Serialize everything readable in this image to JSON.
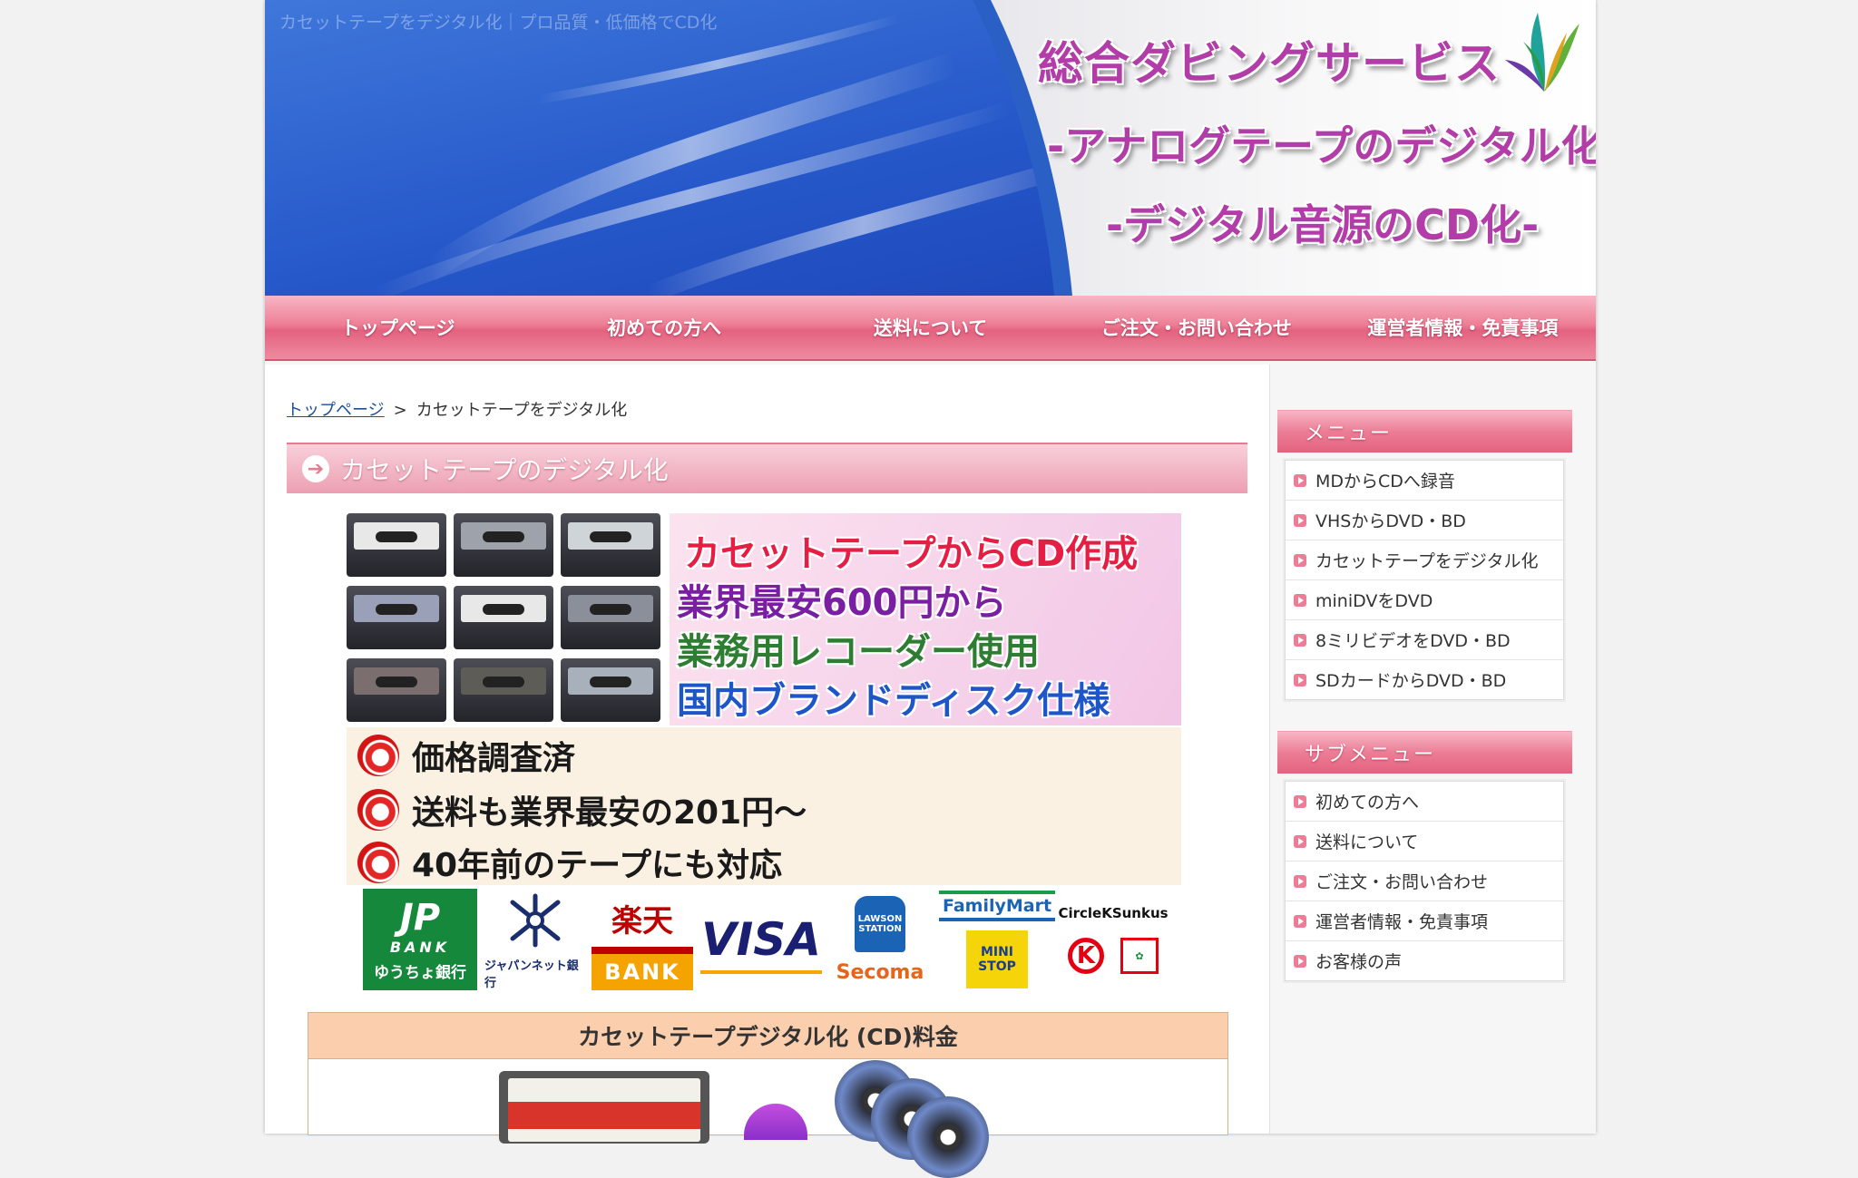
{
  "header": {
    "tagline": "カセットテープをデジタル化｜プロ品質・低価格でCD化",
    "hero_line1": "総合ダビングサービス",
    "hero_line2": "-アナログテープのデジタル化-",
    "hero_line3": "-デジタル音源のCD化-",
    "logo_icon": "leaf-logo-icon"
  },
  "nav": {
    "items": [
      "トップページ",
      "初めての方へ",
      "送料について",
      "ご注文・お問い合わせ",
      "運営者情報・免責事項"
    ]
  },
  "breadcrumb": {
    "home": "トップページ",
    "separator": ">",
    "current": "カセットテープをデジタル化"
  },
  "main": {
    "heading": "カセットテープのデジタル化",
    "heading_icon": "arrow-right-circle-icon",
    "banner": {
      "promo1": "カセットテープからCD作成",
      "promo2": "業界最安600円から",
      "promo3": "業務用レコーダー使用",
      "promo4": "国内ブランドディスク仕様",
      "features": [
        "価格調査済",
        "送料も業界最安の201円〜",
        "40年前のテープにも対応"
      ]
    },
    "payments": {
      "jp_bank": {
        "big": "JP",
        "small": "BANK",
        "name": "ゆうちょ銀行"
      },
      "japannet": "ジャパンネット銀行",
      "rakuten": {
        "top": "楽天",
        "bottom": "BANK"
      },
      "visa": "VISA",
      "lawson": {
        "can": "LAWSON STATION",
        "seicomart": "Secoma"
      },
      "familymart": {
        "name": "FamilyMart",
        "ministop": "MINI STOP"
      },
      "circlek": {
        "name": "CircleKSunkus",
        "k": "K"
      }
    },
    "price_table": {
      "header": "カセットテープデジタル化 (CD)料金"
    }
  },
  "sidebar": {
    "menu_title": "メニュー",
    "menu_items": [
      "MDからCDへ録音",
      "VHSからDVD・BD",
      "カセットテープをデジタル化",
      "miniDVをDVD",
      "8ミリビデオをDVD・BD",
      "SDカードからDVD・BD"
    ],
    "submenu_title": "サブメニュー",
    "submenu_items": [
      "初めての方へ",
      "送料について",
      "ご注文・お問い合わせ",
      "運営者情報・免責事項",
      "お客様の声"
    ]
  },
  "colors": {
    "accent_pink": "#e4627f",
    "hero_purple": "#b23ca8",
    "sky_blue": "#1e4fc4"
  }
}
